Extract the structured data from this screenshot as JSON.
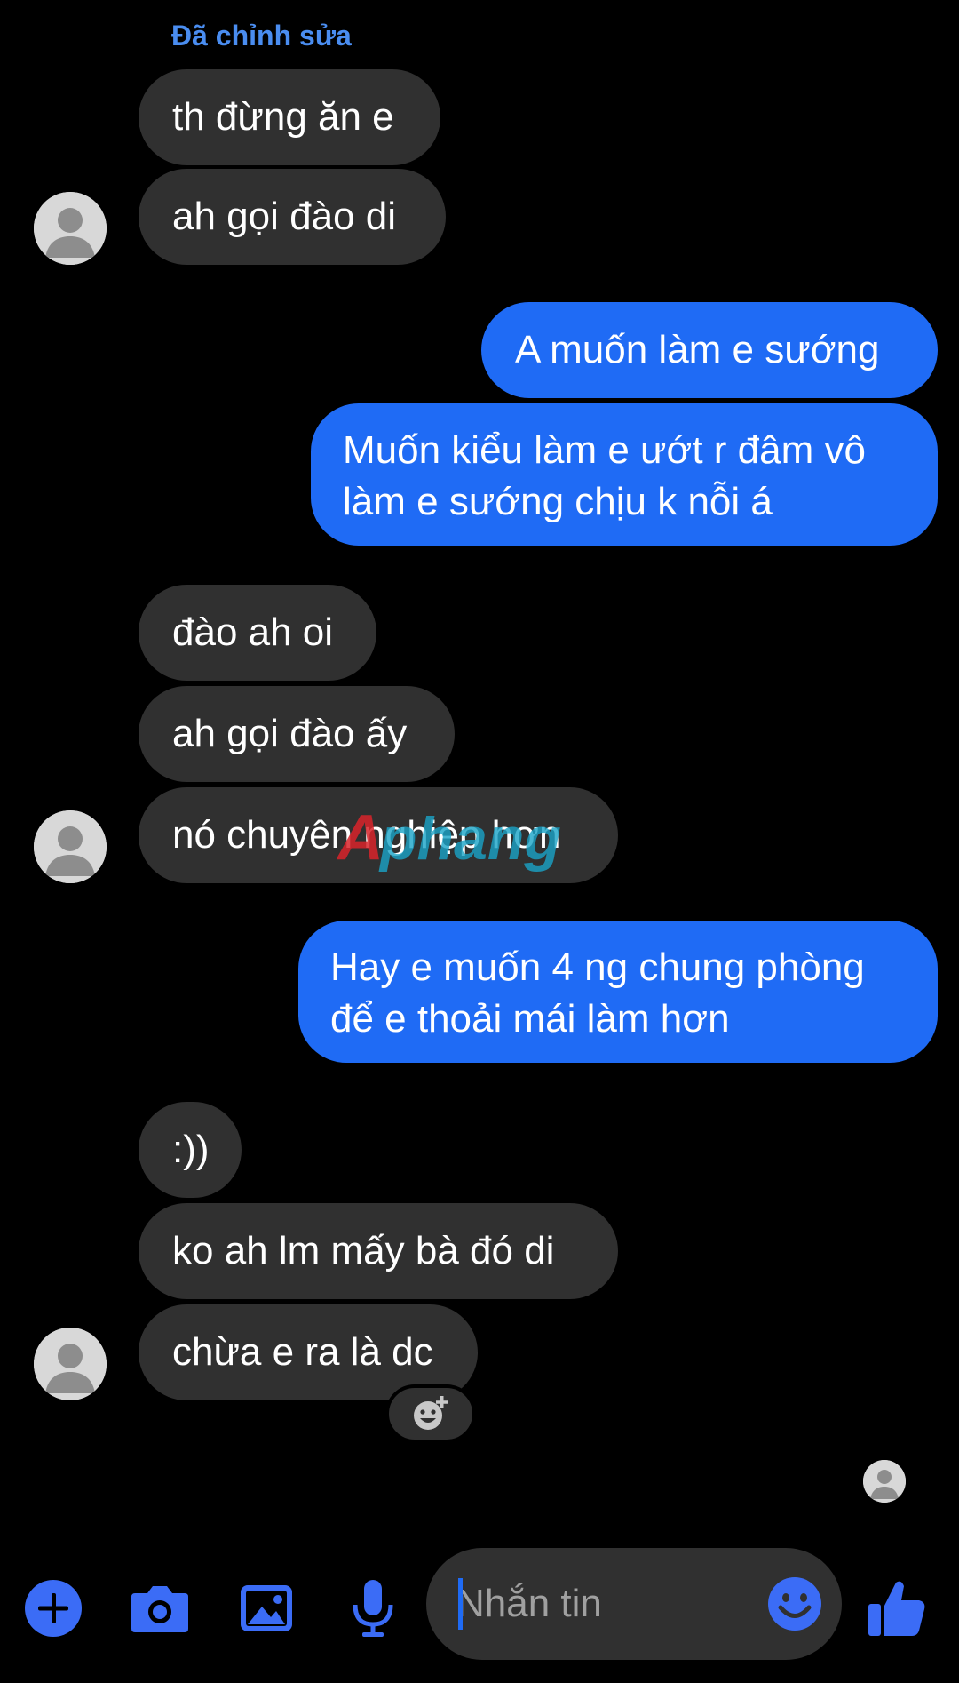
{
  "edited_label": "Đã chỉnh sửa",
  "messages": [
    {
      "text": "th đừng ăn e"
    },
    {
      "text": "ah gọi đào di"
    },
    {
      "text": "A muốn làm e sướng"
    },
    {
      "line1": "Muốn kiểu làm e ướt r đâm vô",
      "line2": "làm e sướng chịu k nỗi á"
    },
    {
      "text": "đào ah oi"
    },
    {
      "text": "ah gọi đào ấy"
    },
    {
      "text": "nó chuyên nghiệp hơn"
    },
    {
      "line1": "Hay e muốn 4 ng chung phòng",
      "line2": "để e thoải mái làm hơn"
    },
    {
      "text": ":))"
    },
    {
      "text": "ko ah lm mấy bà đó di"
    },
    {
      "text": "chừa e ra là dc"
    }
  ],
  "watermark": "Aphang",
  "composer": {
    "placeholder": "Nhắn tin"
  },
  "colors": {
    "incoming_bubble": "#303030",
    "outgoing_bubble": "#1f6bf5",
    "accent": "#3b6cf6",
    "edited_label": "#4a8df0"
  },
  "icons": {
    "toolbar": [
      "plus-icon",
      "camera-icon",
      "image-icon",
      "microphone-icon"
    ],
    "composer": [
      "emoji-icon"
    ],
    "send": "thumbs-up-icon",
    "reaction": "add-reaction-icon"
  }
}
